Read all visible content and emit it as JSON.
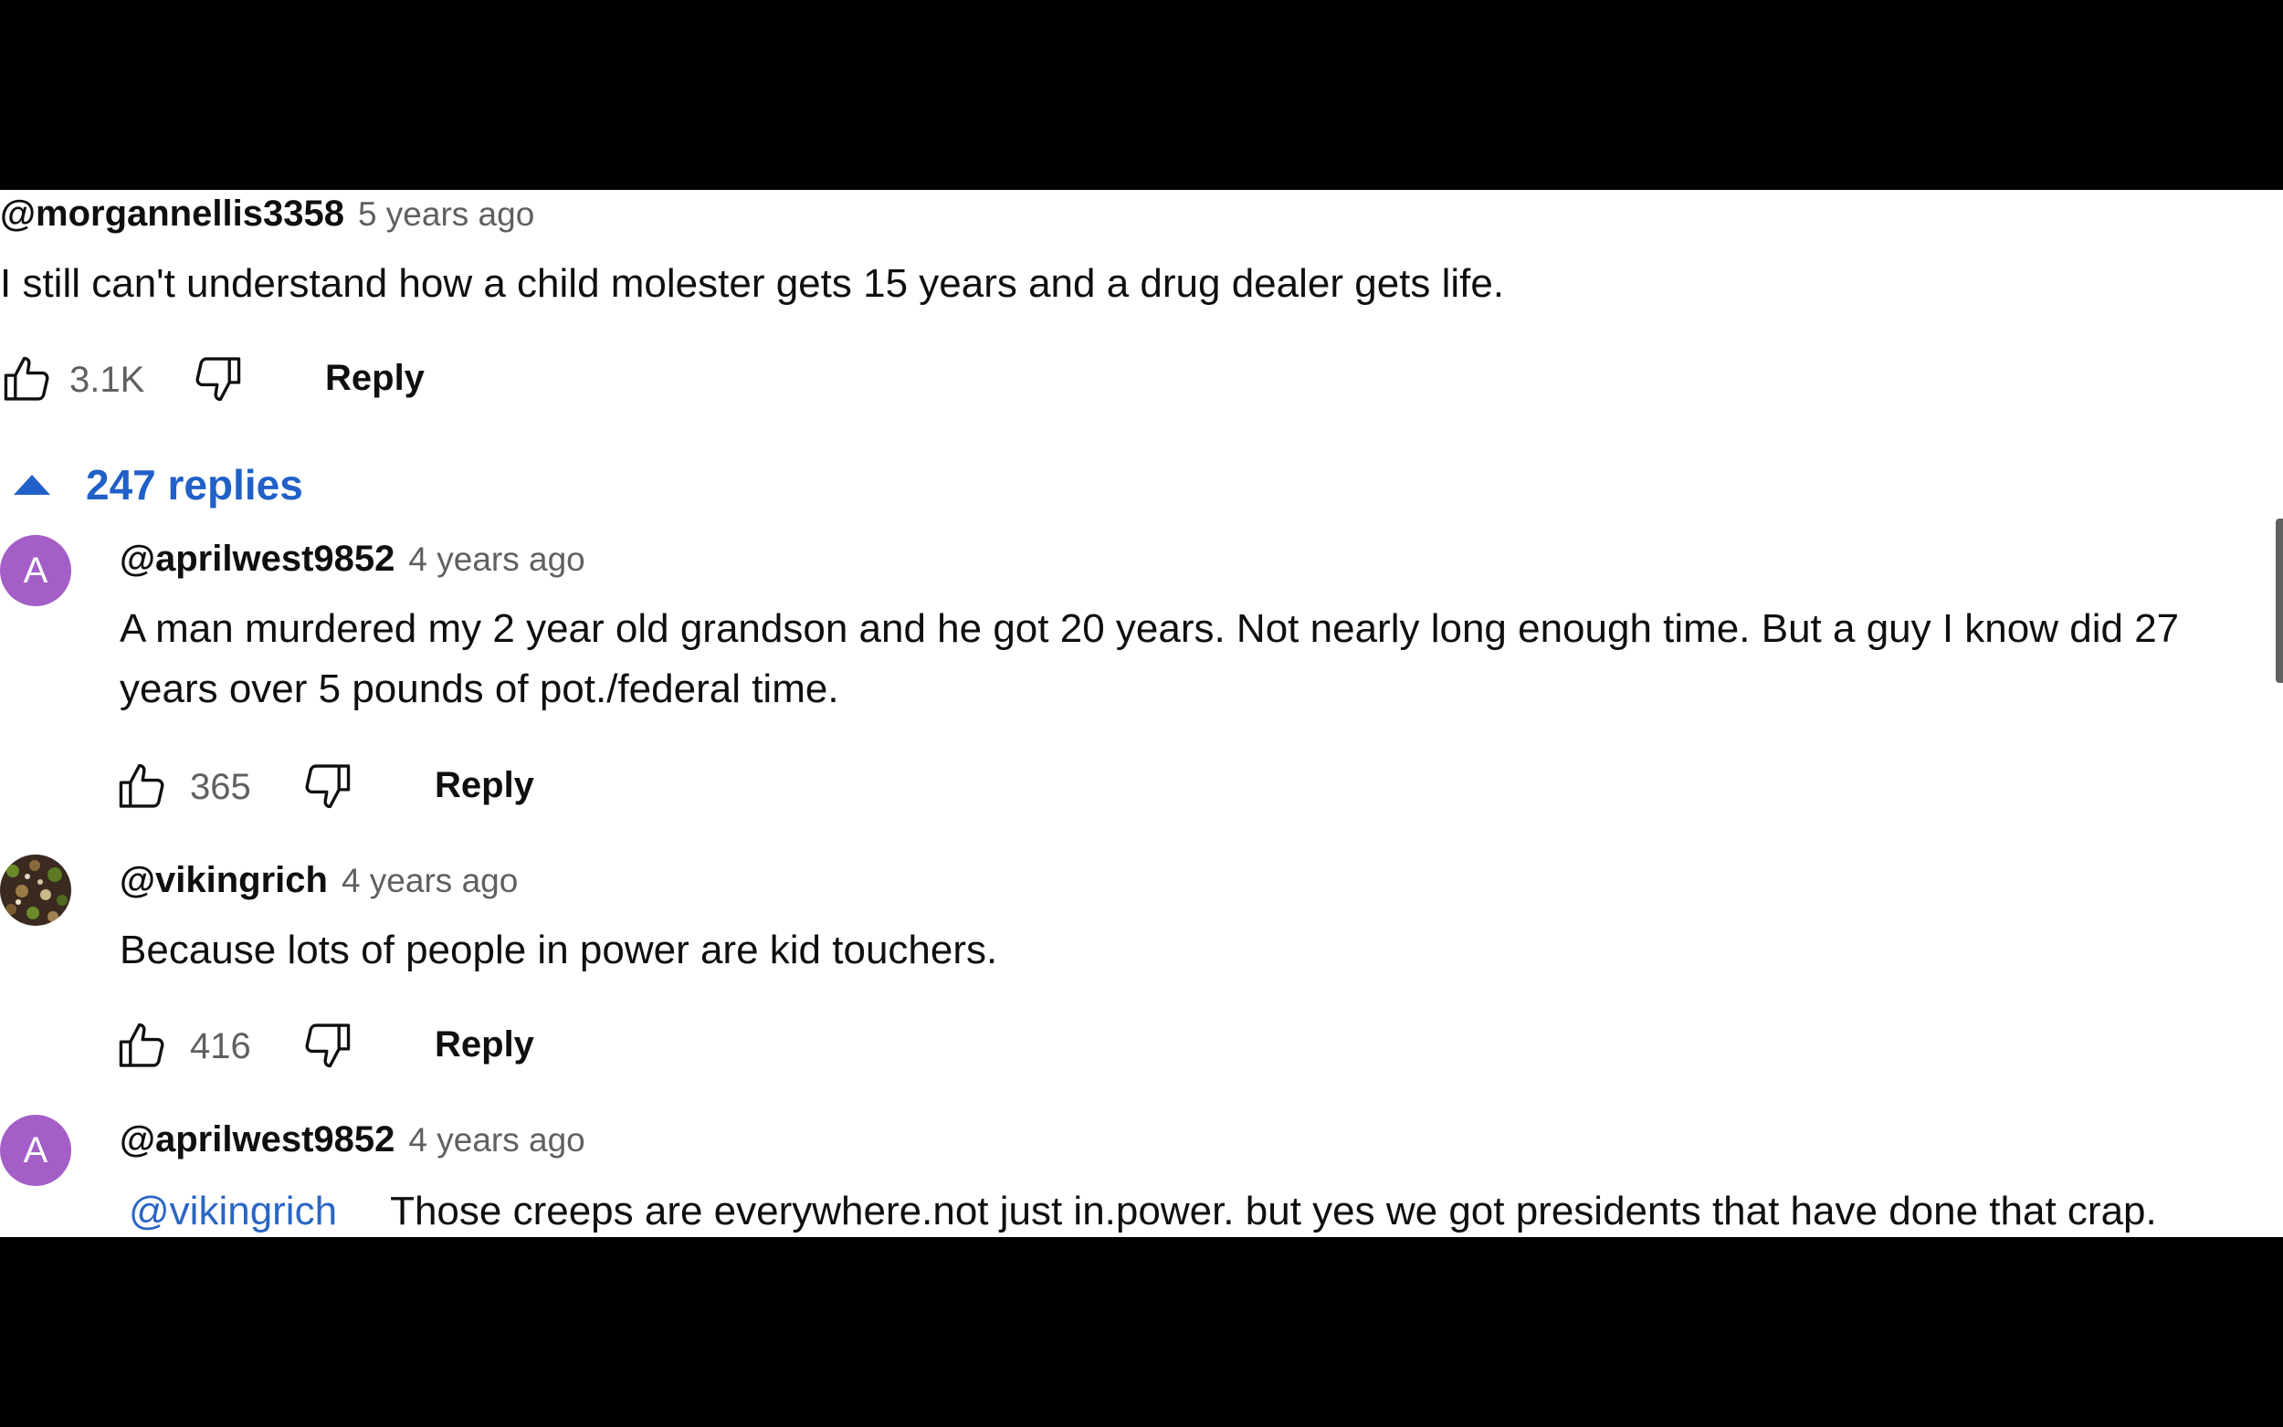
{
  "colors": {
    "link_blue": "#2060c8",
    "avatar_purple": "#a45ec7",
    "text": "#0f0f0f",
    "meta_gray": "#606060"
  },
  "thread": {
    "author": "@morgannellis3358",
    "time": "5 years ago",
    "text": "I still can't understand how a child molester gets 15 years and a drug dealer gets life.",
    "likes": "3.1K",
    "reply_label": "Reply",
    "replies_label": "247 replies"
  },
  "replies": [
    {
      "avatar_letter": "A",
      "author": "@aprilwest9852",
      "time": "4 years ago",
      "text_line1": "A man murdered my 2 year old grandson and he got 20 years.   Not nearly long enough time.  But a guy I know did 27",
      "text_line2": "years over 5 pounds of pot./federal time.",
      "likes": "365",
      "reply_label": "Reply"
    },
    {
      "avatar_icon": "profile-photo",
      "author": "@vikingrich",
      "time": "4 years ago",
      "text": "Because lots of people in power are kid touchers.",
      "likes": "416",
      "reply_label": "Reply"
    },
    {
      "avatar_letter": "A",
      "author": "@aprilwest9852",
      "time": "4 years ago",
      "mention": "@vikingrich",
      "text": "Those creeps are everywhere.not just in.power.   but yes we got presidents that have done that crap."
    }
  ]
}
